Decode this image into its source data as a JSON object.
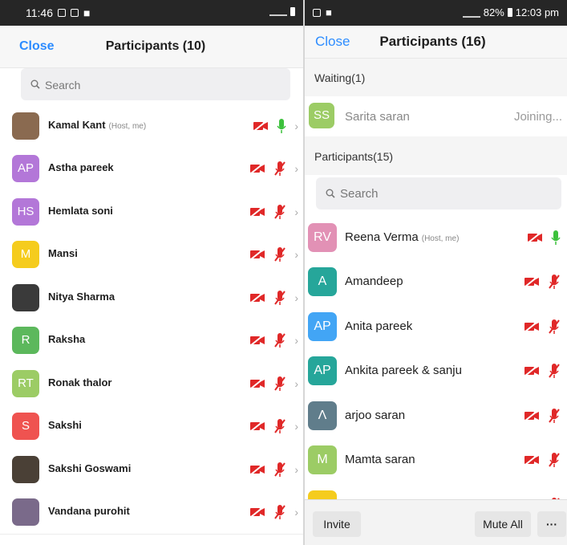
{
  "left": {
    "status": {
      "time": "11:46"
    },
    "header": {
      "close": "Close",
      "title": "Participants (10)"
    },
    "search": {
      "placeholder": "Search"
    },
    "participants": [
      {
        "name": "Kamal Kant",
        "note": "(Host, me)",
        "initials": "",
        "color": "#8a6a50",
        "mic": "on"
      },
      {
        "name": "Astha pareek",
        "note": "",
        "initials": "AP",
        "color": "#b377d8",
        "mic": "muted"
      },
      {
        "name": "Hemlata soni",
        "note": "",
        "initials": "HS",
        "color": "#b377d8",
        "mic": "muted"
      },
      {
        "name": "Mansi",
        "note": "",
        "initials": "M",
        "color": "#f5cc1d",
        "mic": "muted"
      },
      {
        "name": "Nitya Sharma",
        "note": "",
        "initials": "",
        "color": "#3a3a3a",
        "mic": "muted"
      },
      {
        "name": "Raksha",
        "note": "",
        "initials": "R",
        "color": "#5cb85c",
        "mic": "muted"
      },
      {
        "name": "Ronak thalor",
        "note": "",
        "initials": "RT",
        "color": "#9ccc65",
        "mic": "muted"
      },
      {
        "name": "Sakshi",
        "note": "",
        "initials": "S",
        "color": "#ef5350",
        "mic": "muted"
      },
      {
        "name": "Sakshi Goswami",
        "note": "",
        "initials": "",
        "color": "#4a4036",
        "mic": "muted"
      },
      {
        "name": "Vandana purohit",
        "note": "",
        "initials": "",
        "color": "#7a6a8a",
        "mic": "muted"
      }
    ]
  },
  "right": {
    "status": {
      "battery": "82%",
      "time": "12:03 pm"
    },
    "header": {
      "close": "Close",
      "title": "Participants (16)"
    },
    "waiting": {
      "label": "Waiting(1)",
      "person": {
        "name": "Sarita saran",
        "initials": "SS",
        "color": "#9ccc65",
        "status": "Joining..."
      }
    },
    "participants_label": "Participants(15)",
    "search": {
      "placeholder": "Search"
    },
    "participants": [
      {
        "name": "Reena Verma",
        "note": "(Host, me)",
        "initials": "RV",
        "color": "#e291b5",
        "mic": "on"
      },
      {
        "name": "Amandeep",
        "note": "",
        "initials": "A",
        "color": "#26a69a",
        "mic": "muted"
      },
      {
        "name": "Anita pareek",
        "note": "",
        "initials": "AP",
        "color": "#42a5f5",
        "mic": "muted"
      },
      {
        "name": "Ankita pareek & sanju",
        "note": "",
        "initials": "AP",
        "color": "#26a69a",
        "mic": "muted"
      },
      {
        "name": "arjoo saran",
        "note": "",
        "initials": "Λ",
        "color": "#607d8b",
        "mic": "muted"
      },
      {
        "name": "Mamta  saran",
        "note": "",
        "initials": "M",
        "color": "#9ccc65",
        "mic": "muted"
      },
      {
        "name": "",
        "note": "",
        "initials": "",
        "color": "#f5cc1d",
        "mic": "muted"
      }
    ],
    "bottom": {
      "invite": "Invite",
      "mute_all": "Mute All",
      "more": "···"
    }
  },
  "colors": {
    "accent": "#2d8cff",
    "muted": "#e02828",
    "mic_on": "#3cc13c"
  }
}
